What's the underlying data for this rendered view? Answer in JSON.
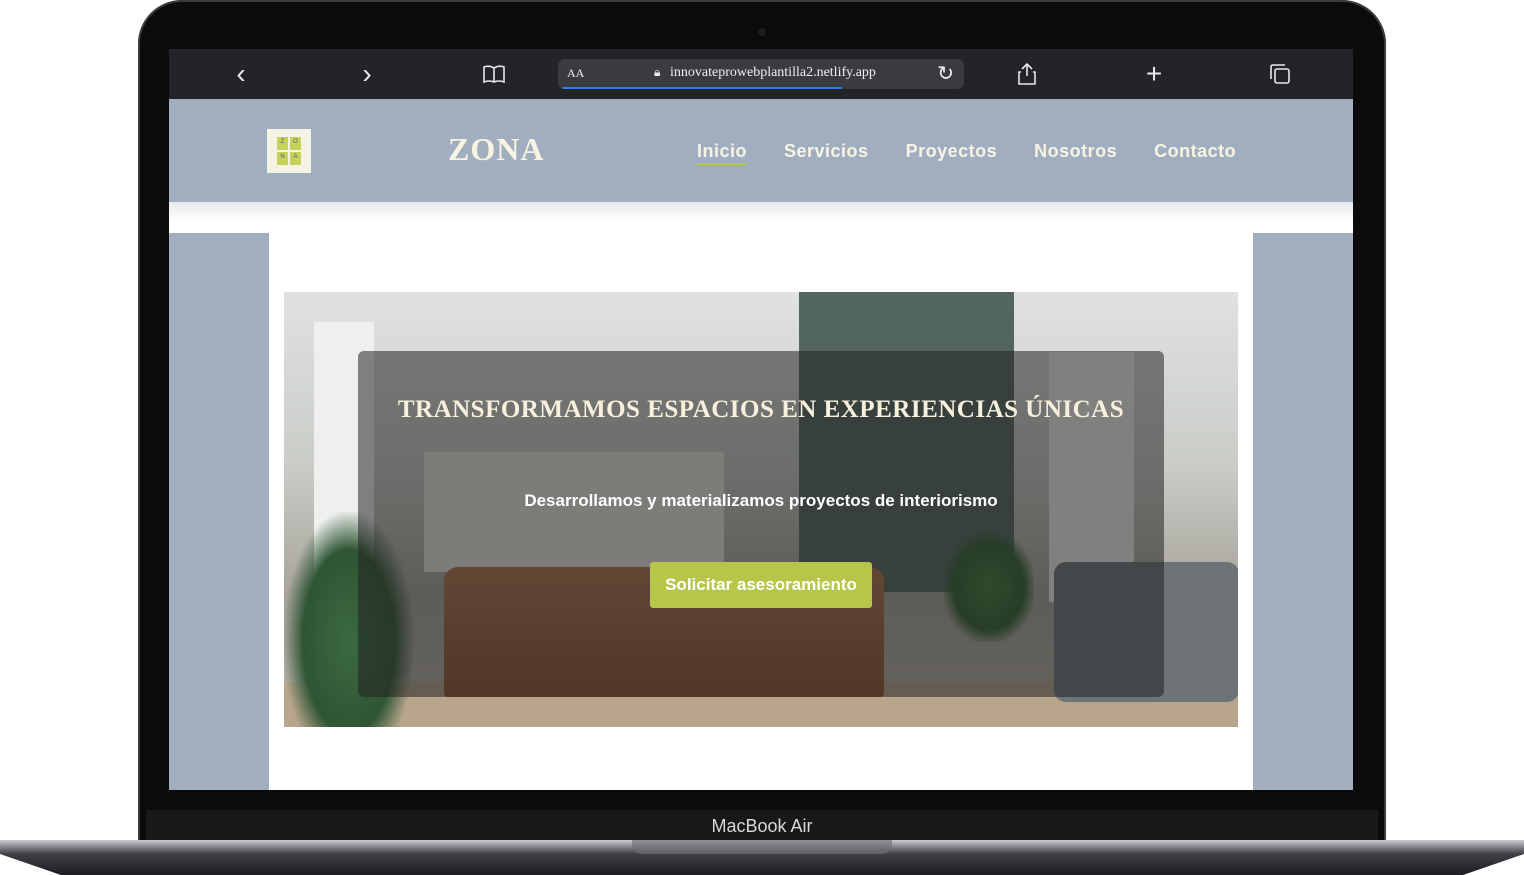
{
  "device": {
    "model_label": "MacBook Air"
  },
  "browser": {
    "back_icon": "‹",
    "forward_icon": "›",
    "bookmarks_icon": "book-icon",
    "aa_label": "AA",
    "url": "innovateprowebplantilla2.netlify.app",
    "share_icon": "share-icon",
    "new_tab_icon": "+",
    "tabs_icon": "tabs-icon"
  },
  "site": {
    "brand": "ZONA",
    "logo_letters": [
      "Z",
      "O",
      "N",
      "A"
    ],
    "nav": [
      {
        "label": "Inicio",
        "active": true
      },
      {
        "label": "Servicios"
      },
      {
        "label": "Proyectos"
      },
      {
        "label": "Nosotros"
      },
      {
        "label": "Contacto"
      }
    ],
    "hero": {
      "title": "TRANSFORMAMOS ESPACIOS EN EXPERIENCIAS ÚNICAS",
      "subtitle": "Desarrollamos y materializamos proyectos de interiorismo",
      "cta": "Solicitar asesoramiento"
    }
  },
  "colors": {
    "header_bg": "#a1aebf",
    "brand_text": "#f7f4e4",
    "accent": "#b5c649"
  }
}
